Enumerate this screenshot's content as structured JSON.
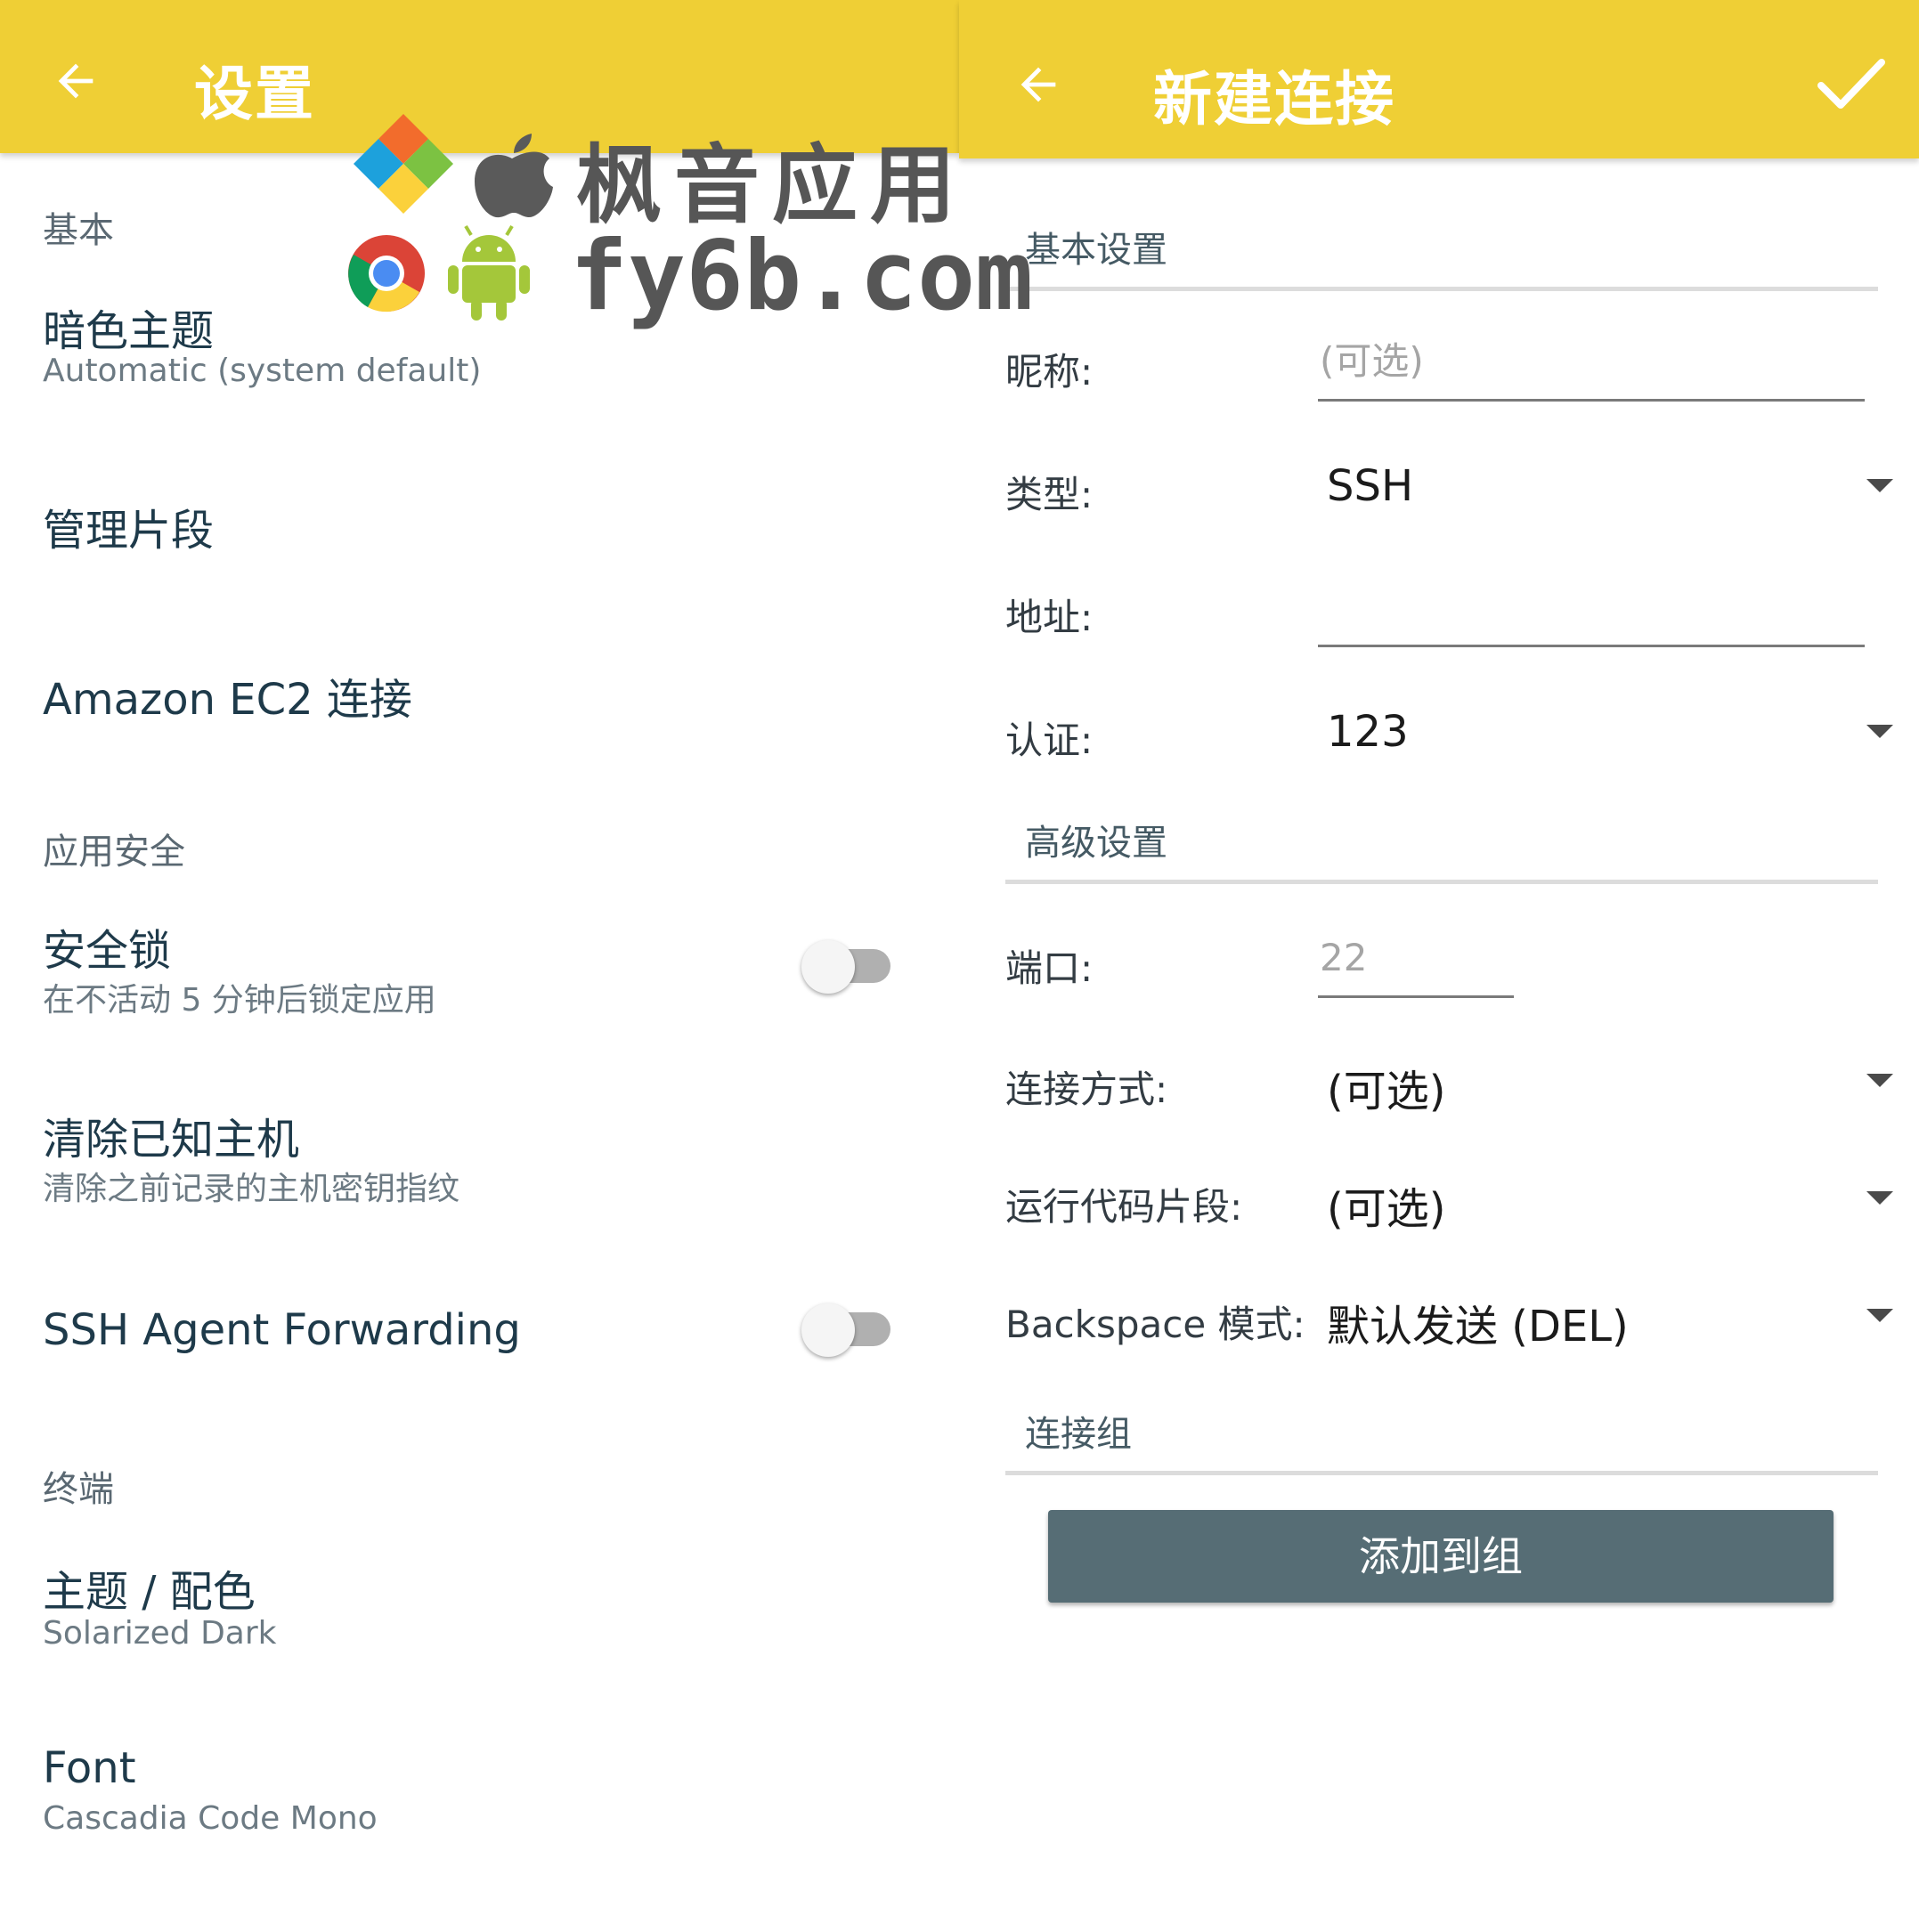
{
  "colors": {
    "appbar": "#efcf35",
    "button": "#566d75"
  },
  "settings": {
    "title": "设置",
    "sections": {
      "basic": "基本",
      "security": "应用安全",
      "terminal": "终端"
    },
    "items": {
      "dark_theme": {
        "title": "暗色主题",
        "summary": "Automatic (system default)"
      },
      "snippets": {
        "title": "管理片段"
      },
      "ec2": {
        "title": "Amazon EC2 连接"
      },
      "lock": {
        "title": "安全锁",
        "summary": "在不活动 5 分钟后锁定应用",
        "enabled": false
      },
      "clear_hosts": {
        "title": "清除已知主机",
        "summary": "清除之前记录的主机密钥指纹"
      },
      "agent_forwarding": {
        "title": "SSH Agent Forwarding",
        "enabled": false
      },
      "theme": {
        "title": "主题 / 配色",
        "summary": "Solarized Dark"
      },
      "font": {
        "title": "Font",
        "summary": "Cascadia Code Mono"
      }
    }
  },
  "new_connection": {
    "title": "新建连接",
    "basic_section": "基本设置",
    "nickname_label": "昵称:",
    "nickname_placeholder": "(可选)",
    "type_label": "类型:",
    "type_value": "SSH",
    "address_label": "地址:",
    "address_value": "",
    "auth_label": "认证:",
    "auth_value": "123",
    "advanced_section": "高级设置",
    "port_label": "端口:",
    "port_placeholder": "22",
    "method_label": "连接方式:",
    "method_value": "(可选)",
    "snippet_label": "运行代码片段:",
    "snippet_value": "(可选)",
    "backspace_label": "Backspace 模式:",
    "backspace_value": "默认发送 (DEL)",
    "group_section": "连接组",
    "add_group_button": "添加到组"
  },
  "watermark": {
    "name": "枫音应用",
    "url": "fy6b.com",
    "icons": [
      "windows-logo-icon",
      "apple-logo-icon",
      "chrome-logo-icon",
      "android-logo-icon"
    ]
  }
}
